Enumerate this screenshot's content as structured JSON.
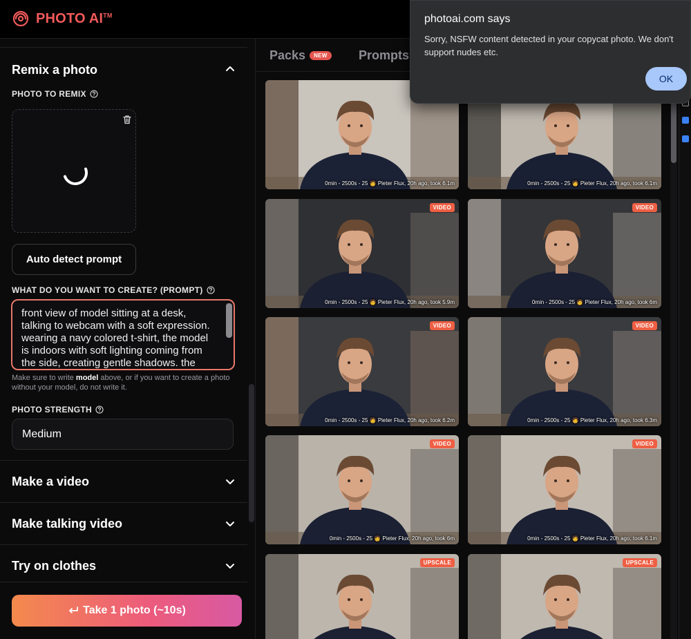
{
  "brand": {
    "name": "PHOTO AI",
    "tm": "TM",
    "color": "#f25a5a"
  },
  "left_panel": {
    "remix_section": {
      "title": "Remix a photo",
      "photo_label": "PHOTO TO REMIX",
      "auto_detect_label": "Auto detect prompt",
      "prompt_label": "WHAT DO YOU WANT TO CREATE? (PROMPT)",
      "prompt_value": "front view of model sitting at a desk, talking to webcam with a soft expression. wearing a navy colored t-shirt, the model is indoors with soft lighting coming from the side, creating gentle shadows. the",
      "hint_pre": "Make sure to write ",
      "hint_bold": "model",
      "hint_post": " above, or if you want to create a photo without your model, do not write it.",
      "strength_label": "PHOTO STRENGTH",
      "strength_value": "Medium"
    },
    "sections": {
      "video": "Make a video",
      "talking_video": "Make talking video",
      "try_on": "Try on clothes"
    },
    "take_photo_label": "Take 1 photo (~10s)"
  },
  "tabs": {
    "packs": "Packs",
    "packs_badge": "NEW",
    "prompts": "Prompts"
  },
  "photos": [
    {
      "caption": "0min - 2500s - 25 🧑 Pieter Flux, 20h ago, took 6.1m",
      "tag": ""
    },
    {
      "caption": "0min - 2500s - 25 🧑 Pieter Flux, 20h ago, took 6.1m",
      "tag": ""
    },
    {
      "caption": "0min - 2500s - 25 🧑 Pieter Flux, 20h ago, took 5.9m",
      "tag": "VIDEO"
    },
    {
      "caption": "0min - 2500s - 25 🧑 Pieter Flux, 20h ago, took 6m",
      "tag": "VIDEO"
    },
    {
      "caption": "0min - 2500s - 25 🧑 Pieter Flux, 20h ago, took 6.2m",
      "tag": "VIDEO"
    },
    {
      "caption": "0min - 2500s - 25 🧑 Pieter Flux, 20h ago, took 6.3m",
      "tag": "VIDEO"
    },
    {
      "caption": "0min - 2500s - 25 🧑 Pieter Flux, 20h ago, took 6m",
      "tag": "VIDEO"
    },
    {
      "caption": "0min - 2500s - 25 🧑 Pieter Flux, 20h ago, took 6.1m",
      "tag": "VIDEO"
    },
    {
      "caption": "",
      "tag": "UPSCALE"
    },
    {
      "caption": "",
      "tag": "UPSCALE"
    }
  ],
  "dialog": {
    "title": "photoai.com says",
    "message": "Sorry, NSFW content detected in your copycat photo. We don't support nudes etc.",
    "ok_label": "OK"
  },
  "colors": {
    "accent": "#e9786a",
    "tag": "#ee5f44",
    "gradient_start": "#f48a4d",
    "gradient_end": "#d85aa3",
    "dialog_button": "#a8c7fa"
  }
}
